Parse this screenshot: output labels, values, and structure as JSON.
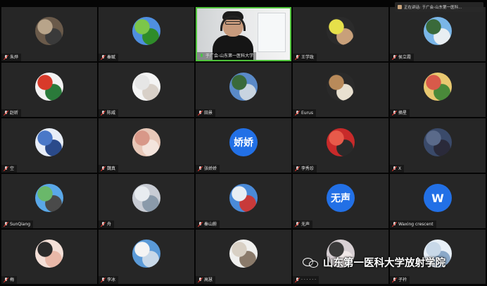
{
  "speaker_banner": {
    "label": "正在讲话: 于广会-山东第一医科..."
  },
  "watermark": {
    "text": "山东第一医科大学放射学院",
    "logo": "wechat-icon"
  },
  "tiles": [
    {
      "name": "朱烨",
      "avatar": "photo",
      "colors": [
        "#6a5a4a",
        "#b8a48a",
        "#3a3a3a"
      ]
    },
    {
      "name": "秦赋",
      "avatar": "photo",
      "colors": [
        "#4f8fe0",
        "#7cc64a",
        "#2f8c2a"
      ]
    },
    {
      "name": "于广会-山东第一医科大学",
      "avatar": "video",
      "active": true
    },
    {
      "name": "王学政",
      "avatar": "photo",
      "colors": [
        "#2b2b2b",
        "#e6e04a",
        "#c8a07a"
      ]
    },
    {
      "name": "侯立霞",
      "avatar": "photo",
      "colors": [
        "#7ab6e8",
        "#3a6a3a",
        "#e8eef2"
      ]
    },
    {
      "name": "赵昕",
      "avatar": "photo",
      "colors": [
        "#f2f2f2",
        "#d83a2a",
        "#2a7a3a"
      ]
    },
    {
      "name": "陈威",
      "avatar": "photo",
      "colors": [
        "#f4f4f4",
        "#e6e6e6",
        "#d8d0c8"
      ]
    },
    {
      "name": "田景",
      "avatar": "photo",
      "colors": [
        "#5a8ac8",
        "#3a6a3a",
        "#c8d4e0"
      ]
    },
    {
      "name": "Eurus",
      "avatar": "photo",
      "colors": [
        "#2a2a2a",
        "#b88a5a",
        "#e8e0d0"
      ]
    },
    {
      "name": "摘星",
      "avatar": "photo",
      "colors": [
        "#e8c870",
        "#d85a4a",
        "#4a8a3a"
      ]
    },
    {
      "name": "空",
      "avatar": "photo",
      "colors": [
        "#e8eef8",
        "#4a78c8",
        "#2a4a8a"
      ]
    },
    {
      "name": "魏真",
      "avatar": "photo",
      "colors": [
        "#e8c8b8",
        "#d89888",
        "#f4e4dc"
      ]
    },
    {
      "name": "张娇娇",
      "avatar": "text",
      "avatar_text": "娇娇"
    },
    {
      "name": "李秀珍",
      "avatar": "photo",
      "colors": [
        "#c82a2a",
        "#e85a4a",
        "#2a2a2a"
      ]
    },
    {
      "name": "X",
      "avatar": "photo",
      "colors": [
        "#3a4a6a",
        "#5a6a8a",
        "#2a2a3a"
      ]
    },
    {
      "name": "SunQiang",
      "avatar": "photo",
      "colors": [
        "#5aa8e8",
        "#6ab86a",
        "#4a4a4a"
      ]
    },
    {
      "name": "舟",
      "avatar": "photo",
      "colors": [
        "#c8ccd4",
        "#e8ecf0",
        "#8a9aaa"
      ]
    },
    {
      "name": "秦山蔚",
      "avatar": "photo",
      "colors": [
        "#4a8ad8",
        "#e8eef4",
        "#c83a3a"
      ]
    },
    {
      "name": "无声",
      "avatar": "text",
      "avatar_text": "无声"
    },
    {
      "name": "Waxing crescent",
      "avatar": "text",
      "avatar_text": "W"
    },
    {
      "name": "梅",
      "avatar": "photo",
      "colors": [
        "#f4e0d8",
        "#2a2a2a",
        "#e8b8a8"
      ]
    },
    {
      "name": "李冰",
      "avatar": "photo",
      "colors": [
        "#5a9ad8",
        "#f4f4f4",
        "#c8d8e8"
      ]
    },
    {
      "name": "高慧",
      "avatar": "photo",
      "colors": [
        "#f0f0ee",
        "#d8d0c4",
        "#8a7a6a"
      ]
    },
    {
      "name": "· · · · · ·",
      "avatar": "photo",
      "colors": [
        "#d8d0d4",
        "#3a3a3a",
        "#f0e8e8"
      ]
    },
    {
      "name": "子衿",
      "avatar": "photo",
      "colors": [
        "#e8f0f8",
        "#c8d8e8",
        "#8aa8c8"
      ]
    }
  ]
}
